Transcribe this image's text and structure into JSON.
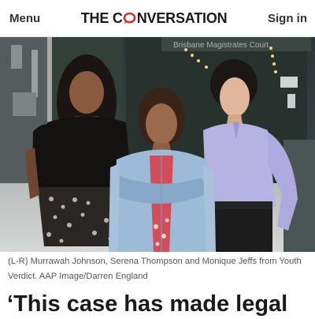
{
  "header": {
    "menu_label": "Menu",
    "logo_part1": "THE C",
    "logo_part2": "NVERSATION",
    "signin_label": "Sign in",
    "logo_accent_color": "#d8352a"
  },
  "photo": {
    "building_sign": "Brisbane Magistrates Court"
  },
  "article": {
    "caption": "(L-R) Murrawah Johnson, Serena Thompson and Monique Jeffs from Youth Verdict. AAP Image/Darren England",
    "headline": "‘This case has made legal"
  }
}
